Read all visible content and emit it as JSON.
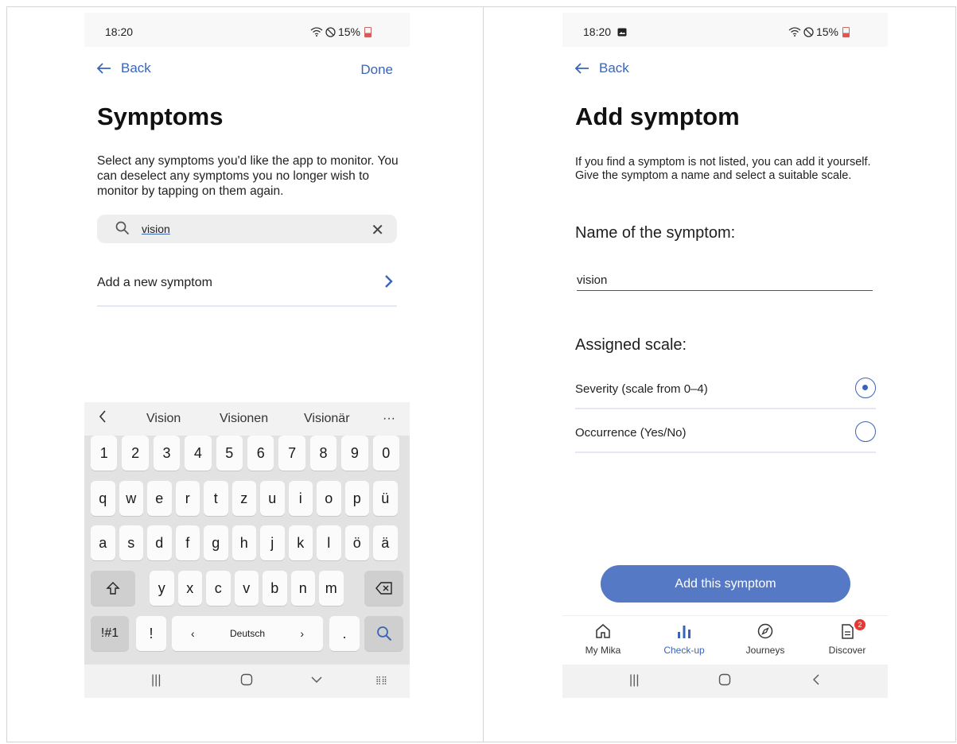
{
  "left": {
    "status": {
      "time": "18:20",
      "battery": "15%"
    },
    "back_label": "Back",
    "done_label": "Done",
    "title": "Symptoms",
    "description": "Select any symptoms you'd like the app to monitor. You can deselect any symptoms you no longer wish to monitor by tapping on them again.",
    "search_value": "vision",
    "add_new_label": "Add a new symptom",
    "keyboard": {
      "suggestions": [
        "Vision",
        "Visionen",
        "Visionär"
      ],
      "more": "···",
      "row_numbers": [
        "1",
        "2",
        "3",
        "4",
        "5",
        "6",
        "7",
        "8",
        "9",
        "0"
      ],
      "row_q": [
        "q",
        "w",
        "e",
        "r",
        "t",
        "z",
        "u",
        "i",
        "o",
        "p",
        "ü"
      ],
      "row_a": [
        "a",
        "s",
        "d",
        "f",
        "g",
        "h",
        "j",
        "k",
        "l",
        "ö",
        "ä"
      ],
      "row_y": [
        "y",
        "x",
        "c",
        "v",
        "b",
        "n",
        "m"
      ],
      "symbols_label": "!#1",
      "excl": "!",
      "space_label": "Deutsch",
      "period": "."
    }
  },
  "right": {
    "status": {
      "time": "18:20",
      "battery": "15%"
    },
    "back_label": "Back",
    "title": "Add symptom",
    "description": "If you find a symptom is not listed, you can add it yourself. Give the symptom a name and select a suitable scale.",
    "name_label": "Name of the symptom:",
    "name_value": "vision",
    "scale_label": "Assigned scale:",
    "options": [
      {
        "label": "Severity (scale from 0–4)",
        "selected": true
      },
      {
        "label": "Occurrence (Yes/No)",
        "selected": false
      }
    ],
    "add_button": "Add this symptom",
    "tabs": [
      {
        "label": "My Mika",
        "icon": "home-icon"
      },
      {
        "label": "Check-up",
        "icon": "bar-chart-icon",
        "active": true
      },
      {
        "label": "Journeys",
        "icon": "compass-icon"
      },
      {
        "label": "Discover",
        "icon": "document-icon",
        "badge": "2"
      }
    ]
  },
  "colors": {
    "accent": "#3a64b8",
    "button": "#5579c4",
    "badge": "#e53935"
  }
}
